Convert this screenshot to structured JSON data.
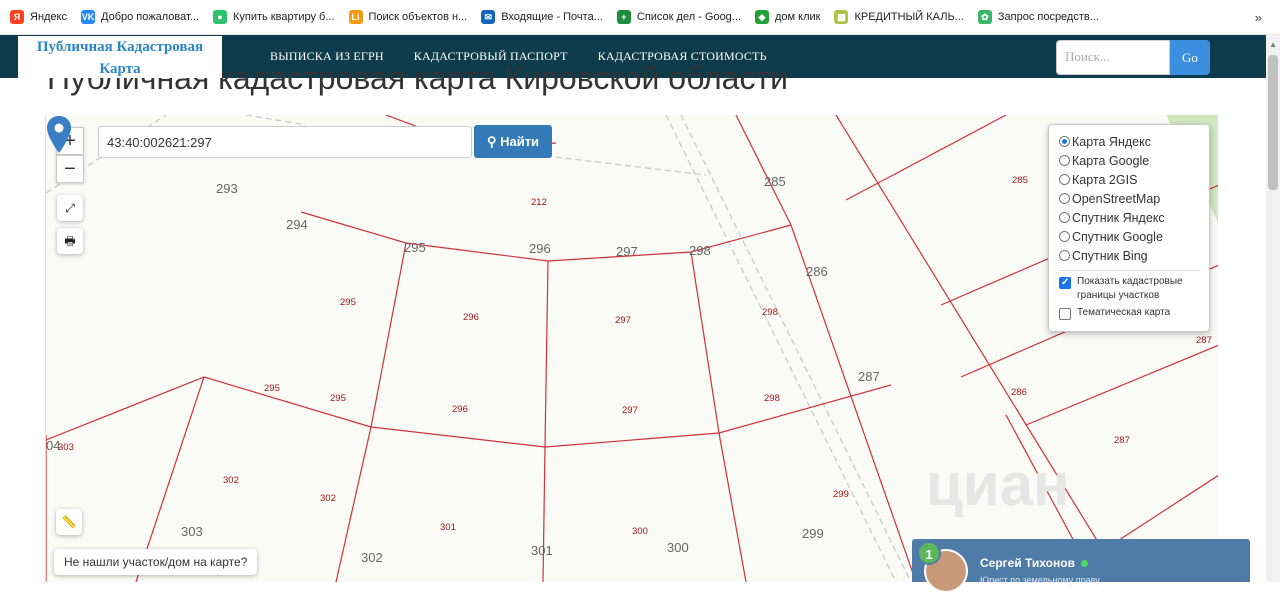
{
  "bookmarks": [
    {
      "label": "Яндекс",
      "icon": "yandex-icon",
      "color": "#fc3f1d",
      "glyph": "Я"
    },
    {
      "label": "Добро пожаловат...",
      "icon": "vk-icon",
      "color": "#2787f5",
      "glyph": "VK"
    },
    {
      "label": "Купить квартиру б...",
      "icon": "cian-icon",
      "color": "#2dc26b",
      "glyph": "●"
    },
    {
      "label": "Поиск объектов н...",
      "icon": "search-object-icon",
      "color": "#f39c12",
      "glyph": "Li"
    },
    {
      "label": "Входящие - Почта...",
      "icon": "mail-icon",
      "color": "#1565c0",
      "glyph": "✉"
    },
    {
      "label": "Список дел - Goog...",
      "icon": "sheets-icon",
      "color": "#1e8e3e",
      "glyph": "+"
    },
    {
      "label": "дом клик",
      "icon": "domclick-icon",
      "color": "#21a038",
      "glyph": "◆"
    },
    {
      "label": "КРЕДИТНЫЙ КАЛЬ...",
      "icon": "calculator-icon",
      "color": "#b0c34a",
      "glyph": "▦"
    },
    {
      "label": "Запрос посредств...",
      "icon": "pinwheel-icon",
      "color": "#3bb56a",
      "glyph": "✿"
    }
  ],
  "bookmarks_more": "»",
  "brand": {
    "line1": "Публичная Кадастровая",
    "line2": "Карта"
  },
  "menu": [
    "ВЫПИСКА ИЗ ЕГРН",
    "КАДАСТРОВЫЙ ПАСПОРТ",
    "КАДАСТРОВАЯ СТОИМОСТЬ"
  ],
  "search": {
    "placeholder": "Поиск...",
    "button": "Go"
  },
  "page_title": "Публичная кадастровая карта Кировской области",
  "map": {
    "zoom_in": "+",
    "zoom_out": "−",
    "cad_number": "43:40:002621:297",
    "find_button": "Найти",
    "layers": [
      {
        "label": "Карта Яндекс",
        "selected": true
      },
      {
        "label": "Карта Google",
        "selected": false
      },
      {
        "label": "Карта 2GIS",
        "selected": false
      },
      {
        "label": "OpenStreetMap",
        "selected": false
      },
      {
        "label": "Спутник Яндекс",
        "selected": false
      },
      {
        "label": "Спутник Google",
        "selected": false
      },
      {
        "label": "Спутник Bing",
        "selected": false
      }
    ],
    "checks": [
      {
        "label": "Показать кадастровые границы участков",
        "checked": true
      },
      {
        "label": "Тематическая карта",
        "checked": false
      }
    ],
    "not_found": "Не нашли участок/дом на карте?",
    "gray_labels": [
      "293",
      "294",
      "295",
      "296",
      "297",
      "298",
      "285",
      "286",
      "287",
      "303",
      "302",
      "301",
      "300",
      "299",
      "04"
    ],
    "red_labels": [
      "212",
      "295",
      "296",
      "297",
      "298",
      "285",
      "287",
      "286",
      "287",
      "295",
      "295",
      "296",
      "297",
      "298",
      "303",
      "302",
      "302",
      "301",
      "300",
      "299"
    ]
  },
  "chat": {
    "badge": "1",
    "name": "Сергей Тихонов",
    "subtitle": "Юрист по земельному праву"
  }
}
